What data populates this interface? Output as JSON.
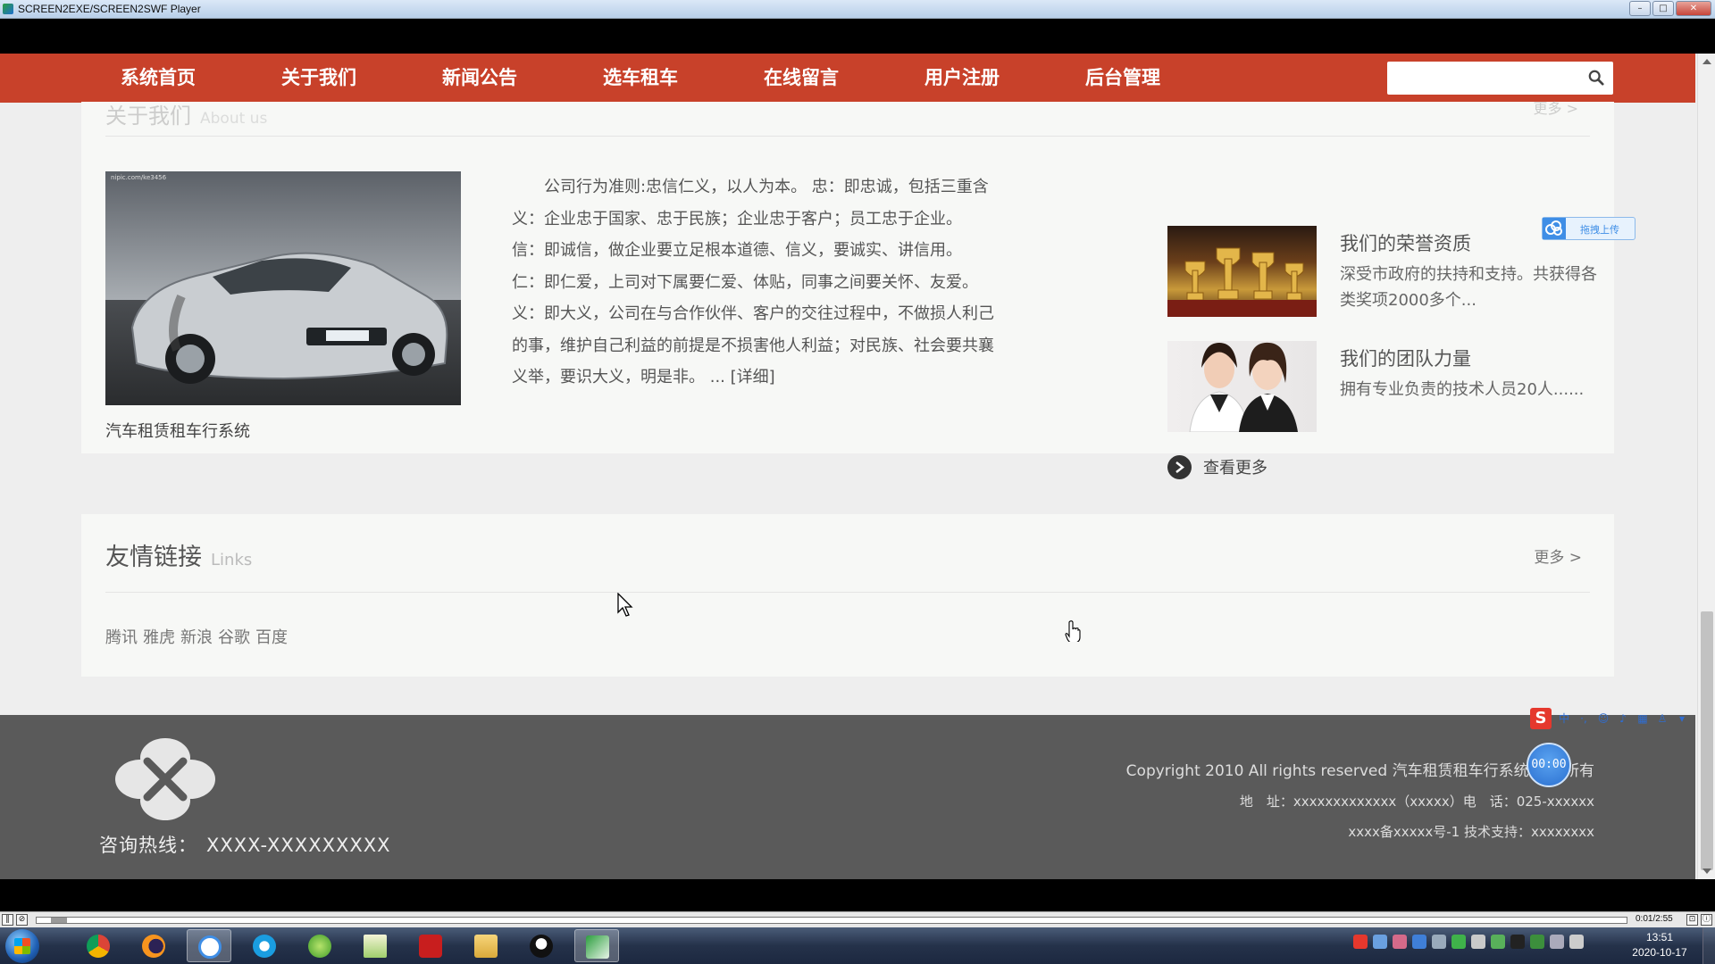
{
  "window": {
    "title": "SCREEN2EXE/SCREEN2SWF Player",
    "minimize": "–",
    "maximize": "□",
    "close": "✕"
  },
  "nav": {
    "items": [
      "系统首页",
      "关于我们",
      "新闻公告",
      "选车租车",
      "在线留言",
      "用户注册",
      "后台管理"
    ],
    "search_value": "",
    "search_icon": "search-icon"
  },
  "about": {
    "heading_ghost": "关于我们",
    "heading_ghost_en": "About us",
    "more_ghost": "更多 >",
    "image_watermark": "nipic.com/ke3456",
    "caption": "汽车租赁租车行系统",
    "body": "公司行为准则:忠信仁义，以人为本。 忠：即忠诚，包括三重含义：企业忠于国家、忠于民族；企业忠于客户；员工忠于企业。 信：即诚信，做企业要立足根本道德、信义，要诚实、讲信用。 仁：即仁爱，上司对下属要仁爱、体贴，同事之间要关怀、友爱。 义：即大义，公司在与合作伙伴、客户的交往过程中，不做损人利己的事，维护自己利益的前提是不损害他人利益；对民族、社会要共襄义举，要识大义，明是非。 ...",
    "detail_link": "[详细]",
    "side": [
      {
        "title": "我们的荣誉资质",
        "desc": "深受市政府的扶持和支持。共获得各类奖项2000多个..."
      },
      {
        "title": "我们的团队力量",
        "desc": "拥有专业负责的技术人员20人......"
      }
    ],
    "view_more": "查看更多"
  },
  "upload_badge": "拖拽上传",
  "links": {
    "heading": "友情链接",
    "heading_en": "Links",
    "more": "更多 >",
    "items": [
      "腾讯",
      "雅虎",
      "新浪",
      "谷歌",
      "百度"
    ]
  },
  "footer": {
    "hotline_label": "咨询热线：",
    "hotline_value": "XXXX-XXXXXXXXX",
    "copyright": "Copyright 2010 All rights reserved 汽车租赁租车行系统 版权所有",
    "address": "地　址：xxxxxxxxxxxxx（xxxxx）电　话：025-xxxxxx",
    "icp": "xxxx备xxxxx号-1 技术支持：xxxxxxxx"
  },
  "ime": {
    "logo": "S",
    "lang": "中"
  },
  "timer_bubble": "00:00",
  "player": {
    "time": "0:01/2:55"
  },
  "taskbar": {
    "time": "13:51",
    "date": "2020-10-17"
  },
  "colors": {
    "nav_bg": "#c8412a",
    "footer_bg": "#5a5a5a",
    "page_bg": "#eeeeee"
  }
}
